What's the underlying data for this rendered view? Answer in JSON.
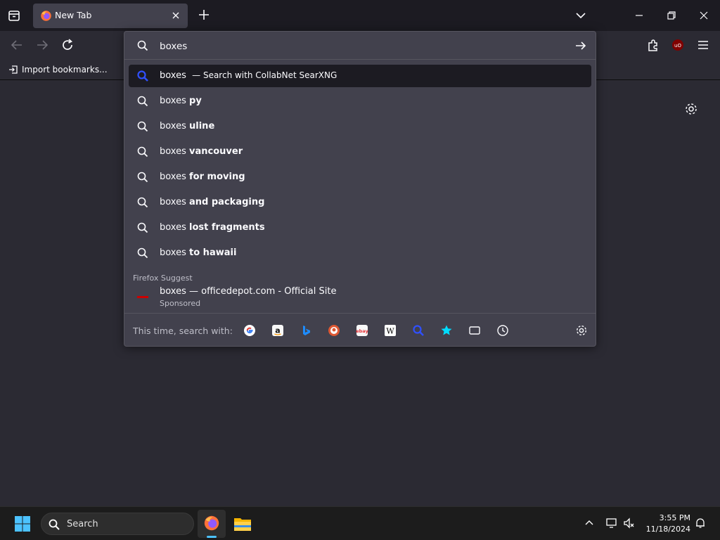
{
  "browser": {
    "tab_title": "New Tab",
    "bookmarks": {
      "import_label": "Import bookmarks..."
    }
  },
  "urlbar": {
    "value": "boxes",
    "results": [
      {
        "prefix": "boxes",
        "suffix": "",
        "action": "— Search with CollabNet SearXNG",
        "selected": true
      },
      {
        "prefix": "boxes",
        "suffix": "py"
      },
      {
        "prefix": "boxes",
        "suffix": "uline"
      },
      {
        "prefix": "boxes",
        "suffix": "vancouver"
      },
      {
        "prefix": "boxes",
        "suffix": "for moving"
      },
      {
        "prefix": "boxes",
        "suffix": "and packaging"
      },
      {
        "prefix": "boxes",
        "suffix": "lost fragments"
      },
      {
        "prefix": "boxes",
        "suffix": "to hawaii"
      }
    ],
    "suggest_label": "Firefox Suggest",
    "sponsored": {
      "title": "boxes — officedepot.com - Official Site",
      "subtitle": "Sponsored"
    },
    "oneoff_label": "This time, search with:",
    "engines": [
      "google-icon",
      "amazon-icon",
      "bing-icon",
      "duckduckgo-icon",
      "ebay-icon",
      "wikipedia-icon",
      "searxng-icon",
      "bookmarks-icon",
      "tabs-icon",
      "history-icon"
    ]
  },
  "taskbar": {
    "search_label": "Search",
    "time": "3:55 PM",
    "date": "11/18/2024"
  },
  "colors": {
    "chrome": "#1c1b22",
    "toolbar": "#2b2a33",
    "popup": "#42414d",
    "accent": "#4cc2ff",
    "searx_blue": "#3050ff"
  }
}
